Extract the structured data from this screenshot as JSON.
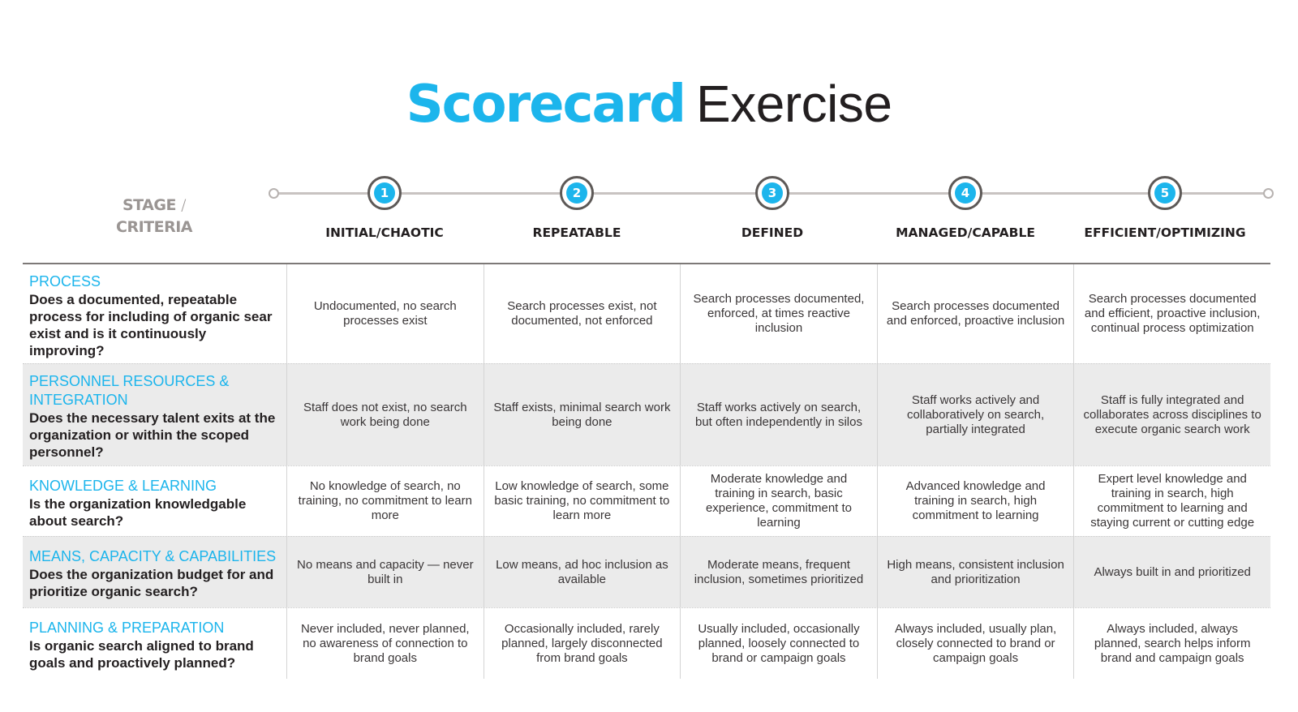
{
  "title": {
    "accent": "Scorecard",
    "rest": "Exercise"
  },
  "colors": {
    "accent": "#1cb5ec",
    "text": "#231f20",
    "muted": "#9a9593",
    "row_shade": "#ebebeb"
  },
  "header": {
    "stage_line1": "STAGE",
    "stage_slash": "/",
    "stage_line2": "CRITERIA"
  },
  "stages": [
    {
      "number": "1",
      "label": "INITIAL/CHAOTIC"
    },
    {
      "number": "2",
      "label": "REPEATABLE"
    },
    {
      "number": "3",
      "label": "DEFINED"
    },
    {
      "number": "4",
      "label": "MANAGED/CAPABLE"
    },
    {
      "number": "5",
      "label": "EFFICIENT/OPTIMIZING"
    }
  ],
  "criteria": [
    {
      "title": "PROCESS",
      "question": "Does a documented, repeatable process for including of organic sear exist and is it continuously improving?",
      "cells": [
        "Undocumented, no search processes exist",
        "Search processes exist, not documented, not enforced",
        "Search processes documented, enforced, at times reactive inclusion",
        "Search processes documented and enforced, proactive inclusion",
        "Search processes documented and efficient, proactive inclusion, continual process optimization"
      ]
    },
    {
      "title": "PERSONNEL RESOURCES & INTEGRATION",
      "question": "Does the necessary talent exits at the organization or within the scoped personnel?",
      "cells": [
        "Staff does not exist, no search work being done",
        "Staff exists, minimal search work being done",
        "Staff works actively on search, but often independently in silos",
        "Staff works actively and collaboratively on search, partially integrated",
        "Staff is fully integrated and collaborates across disciplines to execute organic search work"
      ]
    },
    {
      "title": "KNOWLEDGE & LEARNING",
      "question": "Is the organization knowledgable about search?",
      "cells": [
        "No knowledge of search, no training, no commitment to learn more",
        "Low knowledge of search, some basic training, no commitment to learn more",
        "Moderate knowledge and training in search, basic experience, commitment to learning",
        "Advanced knowledge and training in search, high commitment to learning",
        "Expert level knowledge and training in search, high commitment to learning and staying current or cutting edge"
      ]
    },
    {
      "title": "MEANS, CAPACITY & CAPABILITIES",
      "question": "Does the organization budget for and prioritize organic search?",
      "cells": [
        "No means and capacity — never built in",
        "Low means, ad hoc inclusion as available",
        "Moderate means, frequent inclusion, sometimes prioritized",
        "High means, consistent inclusion and prioritization",
        "Always built in and prioritized"
      ]
    },
    {
      "title": "PLANNING & PREPARATION",
      "question": "Is organic search aligned to brand goals and proactively planned?",
      "cells": [
        "Never included, never planned, no awareness of connection to brand goals",
        "Occasionally included, rarely planned, largely disconnected from brand goals",
        "Usually included, occasionally planned, loosely connected to brand or campaign goals",
        "Always included, usually plan, closely connected to brand or campaign goals",
        "Always included, always planned, search helps inform brand and campaign goals"
      ]
    }
  ]
}
